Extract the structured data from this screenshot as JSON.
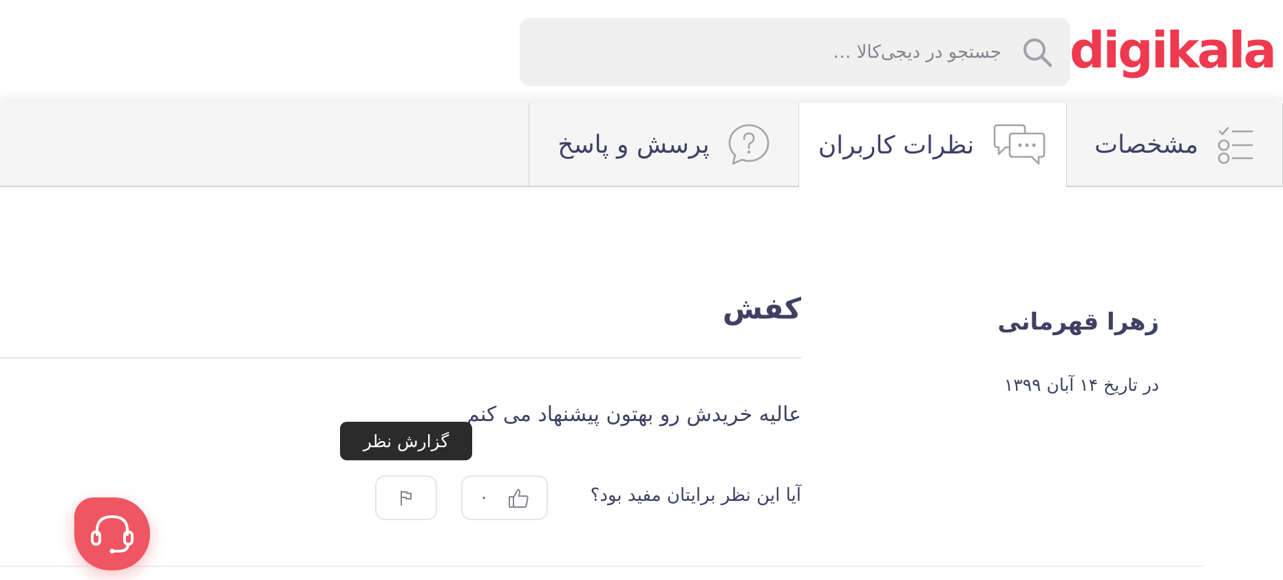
{
  "header": {
    "logo_text": "digikala",
    "search": {
      "placeholder": "جستجو در دیجی‌کالا …",
      "icon": "search-icon"
    }
  },
  "tabs": [
    {
      "label": "مشخصات",
      "icon": "specs-list-icon"
    },
    {
      "label": "نظرات کاربران",
      "icon": "chat-bubbles-icon",
      "active": true
    },
    {
      "label": "پرسش و پاسخ",
      "icon": "question-bubble-icon"
    }
  ],
  "review": {
    "author": "زهرا قهرمانی",
    "date": "در تاریخ ۱۴ آبان ۱۳۹۹",
    "title": "کفش",
    "body": "عالیه خریدش رو بهتون پیشنهاد می کنم",
    "helpful_question": "آیا این نظر برایتان مفید بود؟",
    "likes": "۰",
    "report_tooltip": "گزارش نظر"
  },
  "support": {
    "icon": "headset-icon"
  },
  "colors": {
    "brand": "#ef394e",
    "support": "#ef5662",
    "text": "#3f4064",
    "tooltip_bg": "#2b2b2b"
  }
}
